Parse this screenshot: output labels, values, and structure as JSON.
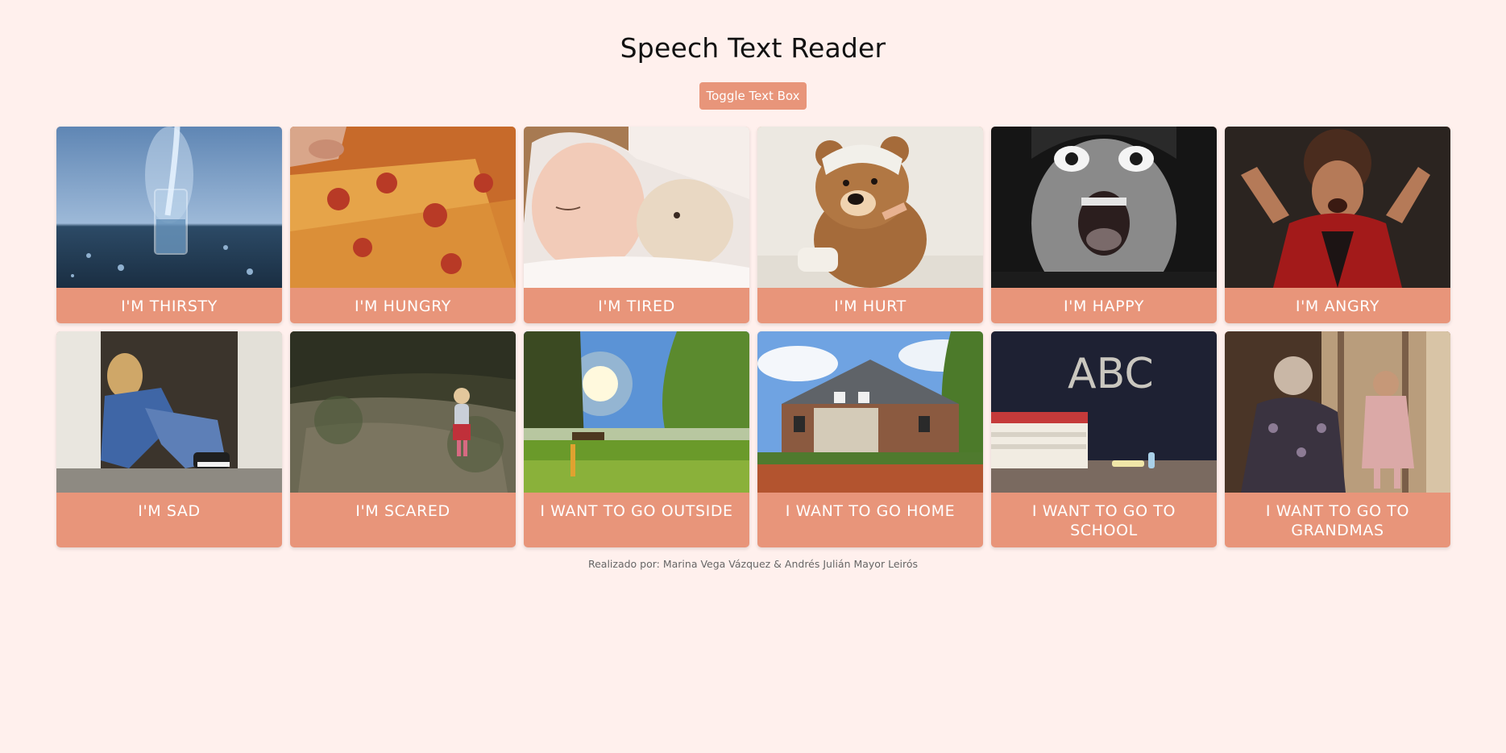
{
  "header": {
    "title": "Speech Text Reader",
    "toggle_label": "Toggle Text Box"
  },
  "cards": [
    {
      "label": "I'M THIRSTY",
      "image": "glass-of-water-image"
    },
    {
      "label": "I'M HUNGRY",
      "image": "pizza-slice-image"
    },
    {
      "label": "I'M TIRED",
      "image": "sleeping-child-image"
    },
    {
      "label": "I'M HURT",
      "image": "bandaged-teddy-bear-image"
    },
    {
      "label": "I'M HAPPY",
      "image": "excited-boy-image"
    },
    {
      "label": "I'M ANGRY",
      "image": "angry-boy-image"
    },
    {
      "label": "I'M SAD",
      "image": "sad-girl-doorway-image"
    },
    {
      "label": "I'M SCARED",
      "image": "child-in-woods-image"
    },
    {
      "label": "I WANT TO GO OUTSIDE",
      "image": "sunny-park-image"
    },
    {
      "label": "I WANT TO GO HOME",
      "image": "house-image"
    },
    {
      "label": "I WANT TO GO TO SCHOOL",
      "image": "chalkboard-abc-image"
    },
    {
      "label": "I WANT TO GO TO GRANDMAS",
      "image": "grandma-and-child-image"
    }
  ],
  "footer": {
    "credits": "Realizado por: Marina Vega Vázquez & Andrés Julián Mayor Leirós"
  }
}
